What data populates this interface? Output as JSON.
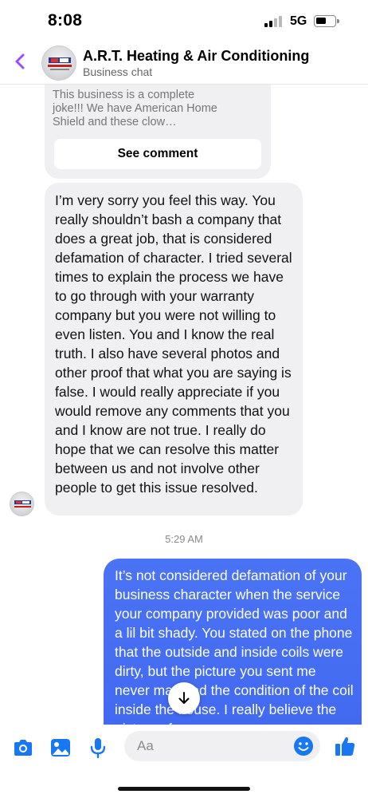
{
  "status_bar": {
    "time": "8:08",
    "network": "5G",
    "icons": [
      "signal-icon",
      "battery-icon"
    ]
  },
  "header": {
    "title": "A.R.T. Heating & Air Conditioning",
    "subtitle": "Business chat",
    "back_icon": "chevron-left-icon",
    "accent_color": "#9b4dff"
  },
  "chat": {
    "quoted_comment": {
      "text": "This business is a complete joke!!! We have American Home Shield and these clow…",
      "button_label": "See comment"
    },
    "incoming_message": "I’m very sorry you feel this way. You really shouldn’t bash a company that does a great job, that is considered defamation of character. I tried several times to explain the process we have to go through with your warranty company but you were not willing to even listen. You and I know the real truth. I also have several photos and other proof that what you are saying is false. I would really appreciate if you would remove any comments that you and I know are not true. I really do hope that we can resolve this matter between us and not involve other people to get this issue resolved.",
    "timestamp": "5:29 AM",
    "outgoing_message": "It’s not considered defamation of your business character when the service your company provided was poor and a lil bit shady. You stated on the phone that the outside and inside coils were dirty, but the picture you sent me never matched the condition of the coil inside the house. I really believe the picture of",
    "outgoing_color": "#4169f0",
    "scroll_icon": "arrow-down-icon"
  },
  "composer": {
    "placeholder": "Aa",
    "icons": [
      "camera-icon",
      "photo-icon",
      "microphone-icon",
      "emoji-icon",
      "thumbs-up-icon"
    ],
    "icon_color": "#1877f2"
  }
}
